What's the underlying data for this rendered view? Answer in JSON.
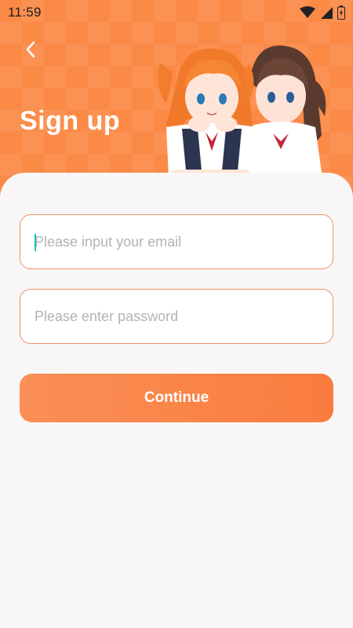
{
  "status_bar": {
    "time": "11:59",
    "icons": [
      "wifi-icon",
      "cell-signal-icon",
      "battery-icon"
    ]
  },
  "header": {
    "back_icon": "chevron-left-icon",
    "title": "Sign up"
  },
  "form": {
    "email": {
      "placeholder": "Please input your email",
      "value": ""
    },
    "password": {
      "placeholder": "Please enter password",
      "value": ""
    },
    "continue_label": "Continue"
  },
  "colors": {
    "brand_orange": "#fb8a47",
    "field_border": "#f0906a",
    "caret": "#19c2b5",
    "card_bg": "#f8f6f7"
  }
}
